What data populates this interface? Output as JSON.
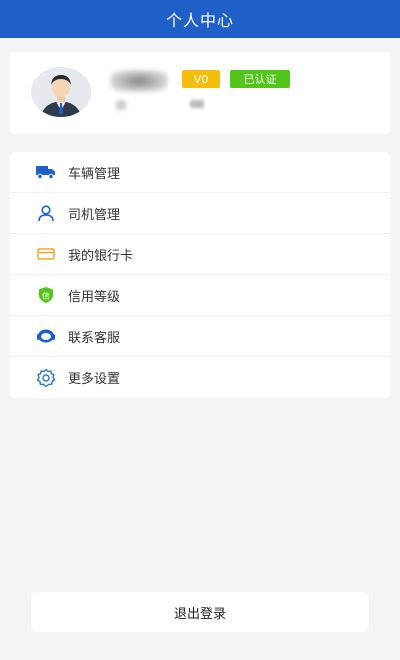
{
  "header": {
    "title": "个人中心"
  },
  "profile": {
    "level_badge": "V0",
    "verified_badge": "已认证",
    "colors": {
      "level": "#f5bd0b",
      "verified": "#52c41a"
    }
  },
  "menu": {
    "items": [
      {
        "label": "车辆管理",
        "icon": "truck-icon"
      },
      {
        "label": "司机管理",
        "icon": "person-icon"
      },
      {
        "label": "我的银行卡",
        "icon": "card-icon"
      },
      {
        "label": "信用等级",
        "icon": "shield-credit-icon"
      },
      {
        "label": "联系客服",
        "icon": "headset-icon"
      },
      {
        "label": "更多设置",
        "icon": "gear-icon"
      }
    ]
  },
  "logout": {
    "label": "退出登录"
  },
  "colors": {
    "primary": "#1e5fc8",
    "background": "#f3f4f6"
  }
}
